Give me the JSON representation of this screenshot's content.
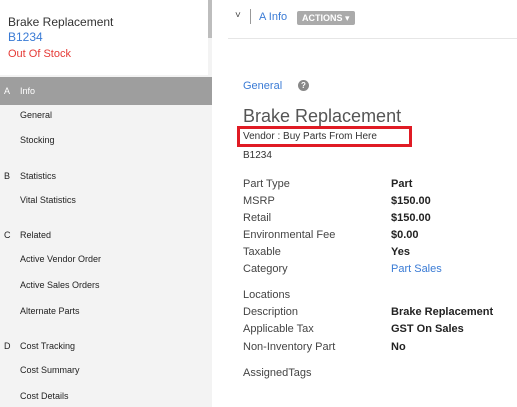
{
  "sidebar": {
    "title": "Brake Replacement",
    "code": "B1234",
    "status": "Out Of Stock",
    "sections": [
      {
        "letter": "A",
        "label": "Info",
        "items": [
          "General",
          "Stocking"
        ]
      },
      {
        "letter": "B",
        "label": "Statistics",
        "items": [
          "Vital Statistics"
        ]
      },
      {
        "letter": "C",
        "label": "Related",
        "items": [
          "Active Vendor Order",
          "Active Sales Orders",
          "Alternate Parts"
        ]
      },
      {
        "letter": "D",
        "label": "Cost Tracking",
        "items": [
          "Cost Summary",
          "Cost Details"
        ]
      }
    ]
  },
  "header": {
    "tab": "A Info",
    "actions": "ACTIONS ▾",
    "chevron": "˅"
  },
  "main": {
    "section": "General",
    "help": "?",
    "title": "Brake Replacement",
    "vendor": "Vendor : Buy Parts From Here",
    "code": "B1234",
    "fields": [
      {
        "label": "Part Type",
        "value": "Part"
      },
      {
        "label": "MSRP",
        "value": "$150.00"
      },
      {
        "label": "Retail",
        "value": "$150.00"
      },
      {
        "label": "Environmental Fee",
        "value": "$0.00"
      },
      {
        "label": "Taxable",
        "value": "Yes"
      },
      {
        "label": "Category",
        "value": "Part Sales"
      }
    ],
    "locations_label": "Locations",
    "fields2": [
      {
        "label": "Description",
        "value": "Brake Replacement"
      },
      {
        "label": "Applicable Tax",
        "value": "GST On Sales"
      },
      {
        "label": "Non-Inventory Part",
        "value": "No"
      }
    ],
    "tags_label": "AssignedTags"
  },
  "colors": {
    "accent": "#3a7bd5",
    "status": "#e53935",
    "highlight": "#e01b24"
  }
}
